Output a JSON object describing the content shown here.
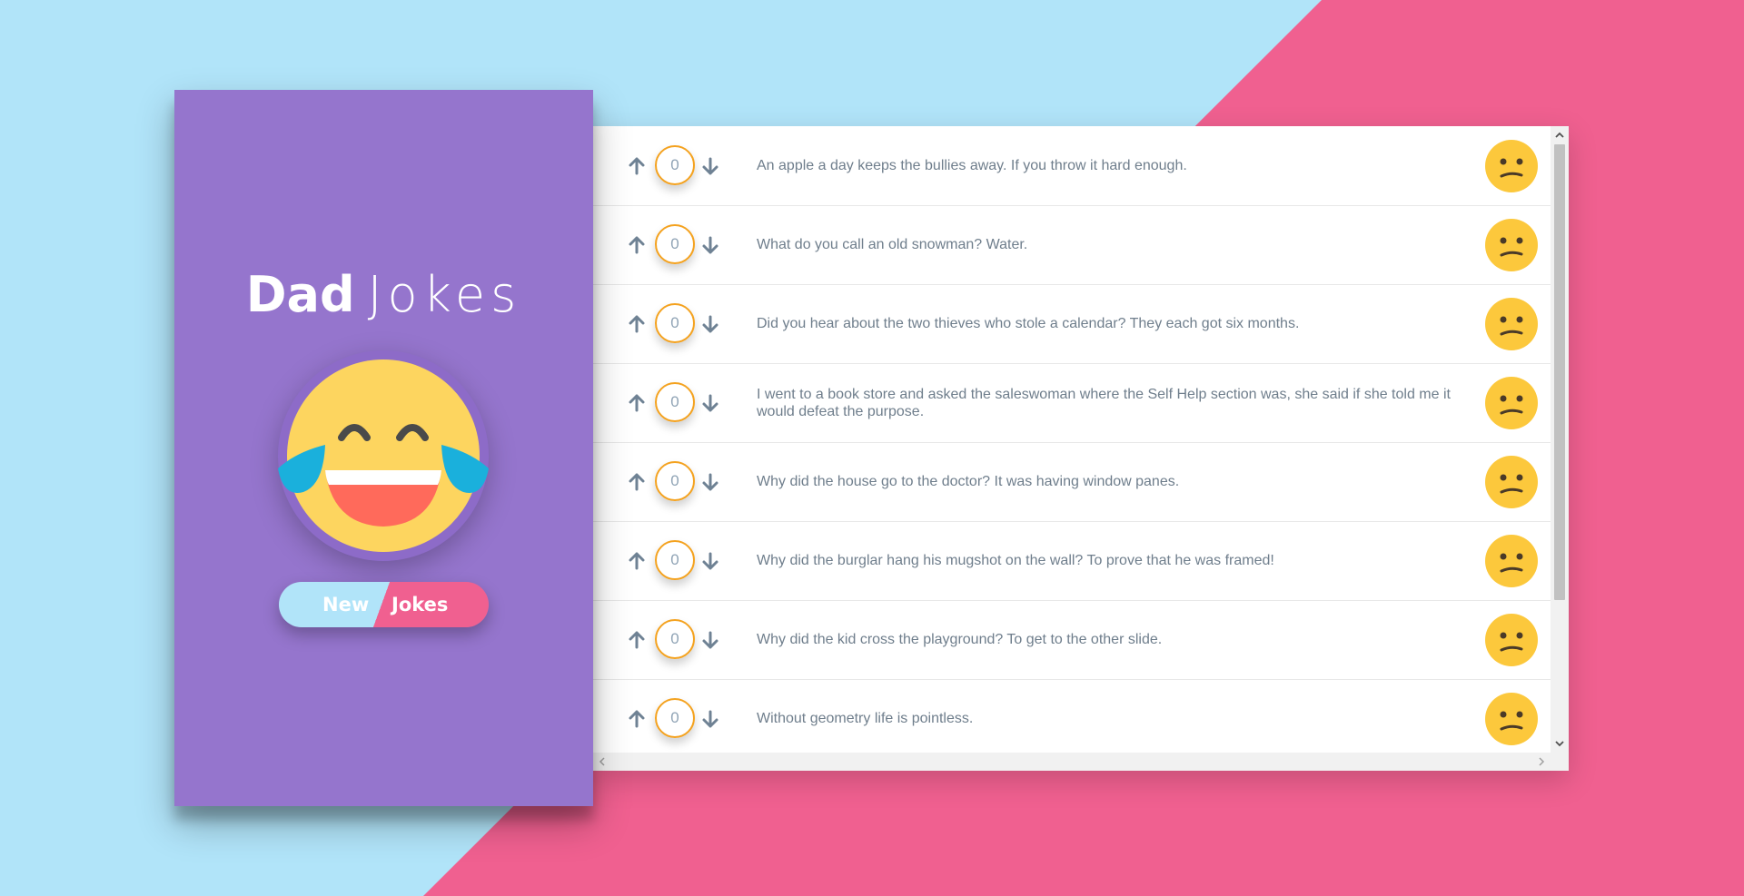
{
  "app": {
    "title_bold": "Dad",
    "title_light": "Jokes",
    "new_button": {
      "part1": "New",
      "part2": "Jokes"
    }
  },
  "colors": {
    "background_blue": "#b1e4f9",
    "background_pink": "#f06090",
    "sidebar": "#9575cd",
    "vote_border": "#f4a21f",
    "emoji_yellow": "#fdd55f"
  },
  "icons": {
    "header_emoji": "tears-of-joy-emoji",
    "row_emoji": "confused-face-emoji",
    "upvote": "arrow-up-icon",
    "downvote": "arrow-down-icon"
  },
  "jokes": [
    {
      "votes": "0",
      "text": "An apple a day keeps the bullies away. If you throw it hard enough."
    },
    {
      "votes": "0",
      "text": "What do you call an old snowman? Water."
    },
    {
      "votes": "0",
      "text": "Did you hear about the two thieves who stole a calendar? They each got six months."
    },
    {
      "votes": "0",
      "text": "I went to a book store and asked the saleswoman where the Self Help section was, she said if she told me it would defeat the purpose."
    },
    {
      "votes": "0",
      "text": "Why did the house go to the doctor? It was having window panes."
    },
    {
      "votes": "0",
      "text": "Why did the burglar hang his mugshot on the wall? To prove that he was framed!"
    },
    {
      "votes": "0",
      "text": "Why did the kid cross the playground? To get to the other slide."
    },
    {
      "votes": "0",
      "text": "Without geometry life is pointless."
    }
  ]
}
